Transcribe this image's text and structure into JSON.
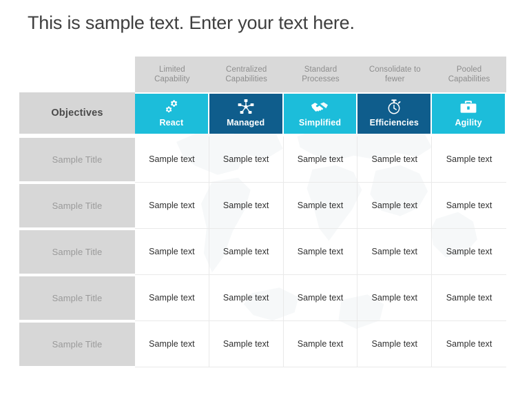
{
  "slide": {
    "title": "This is sample text. Enter your text here.",
    "colors": {
      "teal": "#1cbdda",
      "dark_blue": "#0f5d8c",
      "header_gray": "#d9d9d9",
      "label_gray": "#d7d7d7",
      "title_text": "#3f3f3f",
      "muted_text": "#8d8d8d"
    }
  },
  "table": {
    "row_header_label": "Objectives",
    "column_headers": [
      "Limited\nCapability",
      "Centralized\nCapabilities",
      "Standard\nProcesses",
      "Consolidate to\nfewer",
      "Pooled\nCapabilities"
    ],
    "column_headers_lines": [
      [
        "Limited",
        "Capability"
      ],
      [
        "Centralized",
        "Capabilities"
      ],
      [
        "Standard",
        "Processes"
      ],
      [
        "Consolidate to",
        "fewer"
      ],
      [
        "Pooled",
        "Capabilities"
      ]
    ],
    "stages": [
      {
        "label": "React",
        "icon": "gears-icon",
        "color": "#1cbdda"
      },
      {
        "label": "Managed",
        "icon": "network-icon",
        "color": "#0f5d8c"
      },
      {
        "label": "Simplified",
        "icon": "handshake-icon",
        "color": "#1cbdda"
      },
      {
        "label": "Efficiencies",
        "icon": "stopwatch-icon",
        "color": "#0f5d8c"
      },
      {
        "label": "Agility",
        "icon": "briefcase-icon",
        "color": "#1cbdda"
      }
    ],
    "row_labels": [
      "Sample Title",
      "Sample Title",
      "Sample Title",
      "Sample Title",
      "Sample Title"
    ],
    "rows": [
      [
        "Sample text",
        "Sample text",
        "Sample text",
        "Sample text",
        "Sample text"
      ],
      [
        "Sample text",
        "Sample text",
        "Sample text",
        "Sample text",
        "Sample text"
      ],
      [
        "Sample text",
        "Sample text",
        "Sample text",
        "Sample text",
        "Sample text"
      ],
      [
        "Sample text",
        "Sample text",
        "Sample text",
        "Sample text",
        "Sample text"
      ],
      [
        "Sample text",
        "Sample text",
        "Sample text",
        "Sample text",
        "Sample text"
      ]
    ]
  }
}
